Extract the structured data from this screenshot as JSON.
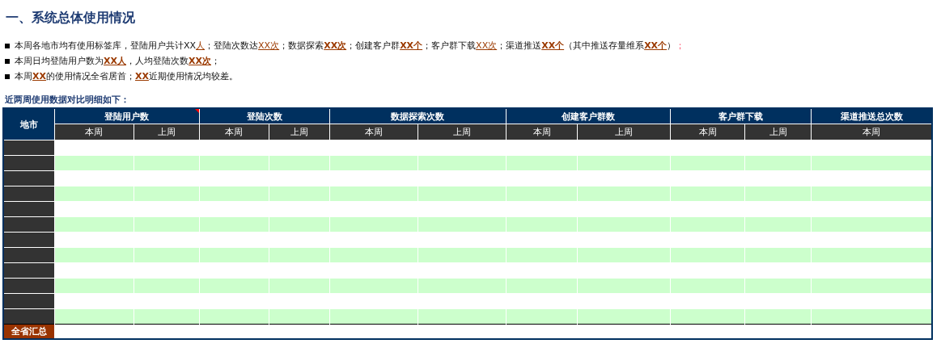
{
  "title": "一、系统总体使用情况",
  "bullets": [
    [
      {
        "kind": "text",
        "text": "本周各地市均有使用标签库，登陆用户共计XX"
      },
      {
        "kind": "mark",
        "text": "人"
      },
      {
        "kind": "text",
        "text": "；登陆次数达"
      },
      {
        "kind": "mark",
        "text": "XX次"
      },
      {
        "kind": "text",
        "text": "；数据探索"
      },
      {
        "kind": "strong",
        "text": "XX次"
      },
      {
        "kind": "text",
        "text": "；创建客户群"
      },
      {
        "kind": "strong",
        "text": "XX个"
      },
      {
        "kind": "text",
        "text": "；客户群下载"
      },
      {
        "kind": "mark",
        "text": "XX次"
      },
      {
        "kind": "text",
        "text": "；渠道推送"
      },
      {
        "kind": "strong",
        "text": "XX个"
      },
      {
        "kind": "text",
        "text": "（其中推送存量维系"
      },
      {
        "kind": "strong",
        "text": "XX个"
      },
      {
        "kind": "text",
        "text": "）"
      },
      {
        "kind": "red",
        "text": "；"
      }
    ],
    [
      {
        "kind": "text",
        "text": "本周日均登陆用户数为"
      },
      {
        "kind": "strong",
        "text": "XX人"
      },
      {
        "kind": "text",
        "text": "，人均登陆次数"
      },
      {
        "kind": "strong",
        "text": "XX次"
      },
      {
        "kind": "text",
        "text": "；"
      }
    ],
    [
      {
        "kind": "text",
        "text": "本周"
      },
      {
        "kind": "strong",
        "text": "XX"
      },
      {
        "kind": "text",
        "text": "的使用情况全省居首；"
      },
      {
        "kind": "strong",
        "text": "XX"
      },
      {
        "kind": "text",
        "text": "近期使用情况均较差。"
      }
    ]
  ],
  "table": {
    "caption": "近两周使用数据对比明细如下：",
    "region_header": "地市",
    "groups": [
      {
        "label": "登陆用户数",
        "has_comment": true,
        "subs": [
          "本周",
          "上周"
        ]
      },
      {
        "label": "登陆次数",
        "has_comment": false,
        "subs": [
          "本周",
          "上周"
        ]
      },
      {
        "label": "数据探索次数",
        "has_comment": false,
        "subs": [
          "本周",
          "上周"
        ]
      },
      {
        "label": "创建客户群数",
        "has_comment": false,
        "subs": [
          "本周",
          "上周"
        ]
      },
      {
        "label": "客户群下载",
        "has_comment": false,
        "subs": [
          "本周",
          "上周"
        ]
      },
      {
        "label": "渠道推送总次数",
        "has_comment": false,
        "subs": [
          "本周"
        ]
      }
    ],
    "rows": [
      {
        "striped": false
      },
      {
        "striped": true
      },
      {
        "striped": false
      },
      {
        "striped": true
      },
      {
        "striped": false
      },
      {
        "striped": true
      },
      {
        "striped": false
      },
      {
        "striped": true
      },
      {
        "striped": false
      },
      {
        "striped": true
      },
      {
        "striped": false
      },
      {
        "striped": true
      }
    ],
    "total_label": "全省汇总"
  }
}
